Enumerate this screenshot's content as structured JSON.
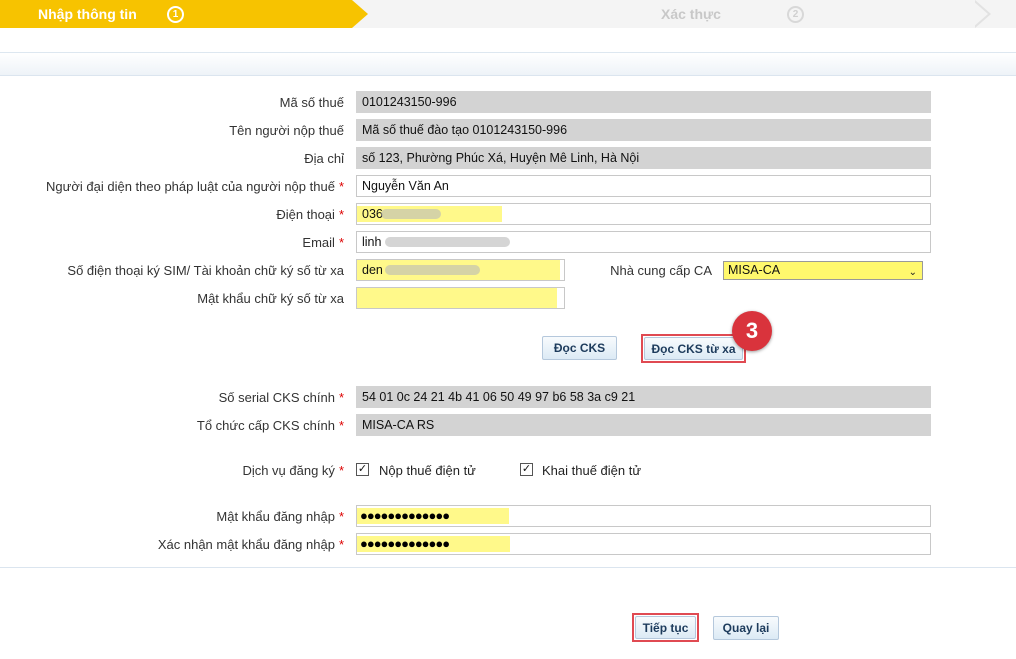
{
  "steps": {
    "step1_label": "Nhập thông tin",
    "step1_num": "1",
    "step2_label": "Xác thực",
    "step2_num": "2"
  },
  "form": {
    "tax_code_label": "Mã số thuế",
    "tax_code_value": "0101243150-996",
    "taxpayer_name_label": "Tên người nộp thuế",
    "taxpayer_name_value": "Mã số thuế đào tạo 0101243150-996",
    "address_label": "Địa chỉ",
    "address_value": "số 123, Phường Phúc Xá, Huyện Mê Linh, Hà Nội",
    "legal_rep_label": "Người đại diện theo pháp luật của người nộp thuế",
    "legal_rep_value": "Nguyễn Văn An",
    "phone_label": "Điện thoại",
    "phone_value": "036",
    "email_label": "Email",
    "email_value": "linh",
    "sim_label": "Số điện thoại ký SIM/ Tài khoản chữ ký số từ xa",
    "sim_value": "den",
    "ca_provider_label": "Nhà cung cấp CA",
    "ca_provider_value": "MISA-CA",
    "remote_pw_label": "Mật khẩu chữ ký số từ xa",
    "read_cks_button": "Đọc CKS",
    "read_remote_cks_button": "Đọc CKS từ xa",
    "step_badge": "3",
    "serial_label": "Số serial CKS chính",
    "serial_value": "54 01 0c 24 21 4b 41 06 50 49 97 b6 58 3a c9 21",
    "issuer_label": "Tổ chức cấp CKS chính",
    "issuer_value": "MISA-CA RS",
    "service_label": "Dịch vụ đăng ký",
    "service_option1": "Nộp thuế điện tử",
    "service_option2": "Khai thuế điện tử",
    "login_pw_label": "Mật khẩu đăng nhập",
    "login_pw_value": "●●●●●●●●●●●●●",
    "confirm_pw_label": "Xác nhận mật khẩu đăng nhập",
    "confirm_pw_value": "●●●●●●●●●●●●●",
    "required_mark": "*"
  },
  "footer": {
    "continue_button": "Tiếp tục",
    "back_button": "Quay lại"
  },
  "colors": {
    "step_active": "#f7c300",
    "highlight": "#fff98a",
    "callout_red": "#d9333c"
  }
}
